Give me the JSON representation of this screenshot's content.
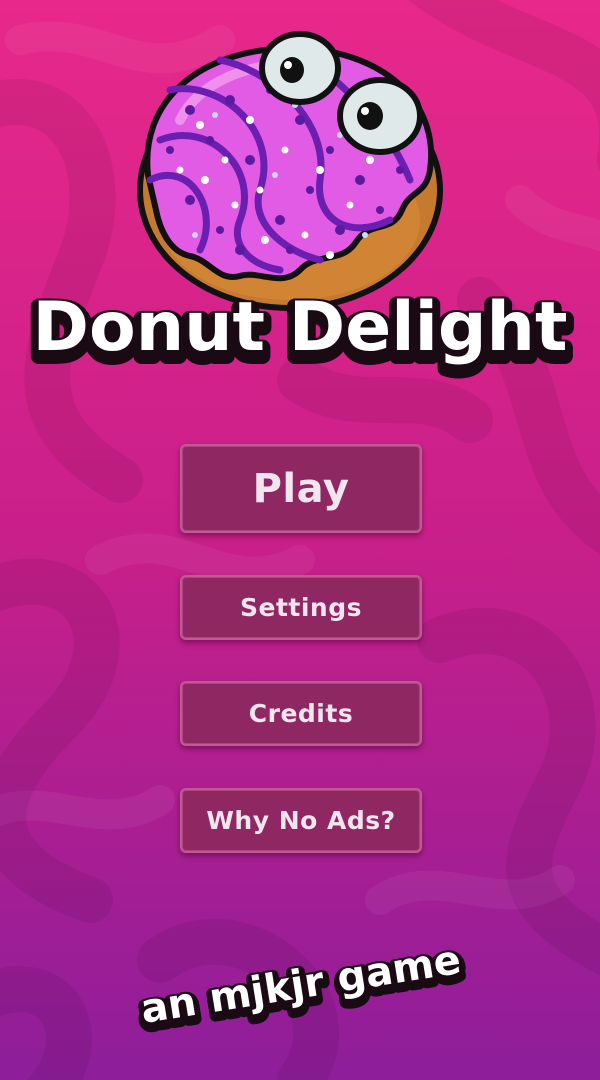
{
  "game": {
    "title": "Donut Delight",
    "byline": "an mjkjr game"
  },
  "menu": {
    "play_label": "Play",
    "settings_label": "Settings",
    "credits_label": "Credits",
    "why_no_ads_label": "Why No Ads?"
  },
  "colors": {
    "background_pink": "#e8288a",
    "background_purple": "#8e1e9a",
    "button_fill": "#8f2763",
    "button_border": "#c05a91",
    "icing_pink": "#e25be4",
    "drizzle_purple": "#6a1fb0",
    "dough_brown": "#c57a2f"
  },
  "icons": {
    "mascot": "donut-mascot-icon"
  }
}
